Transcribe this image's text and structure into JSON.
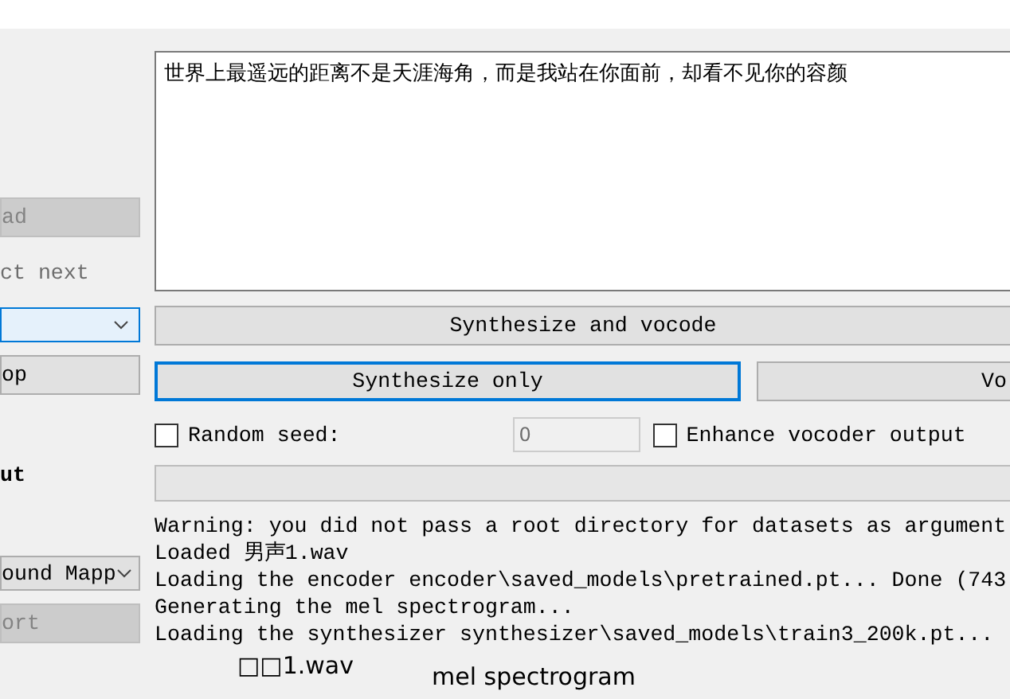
{
  "left_panel": {
    "load_button": {
      "label": "ad",
      "disabled": true
    },
    "select_label": "ct next",
    "stop_button": {
      "label": "op",
      "disabled": false
    },
    "output_heading": "ut",
    "dropdown_2": {
      "value": "ound Mapp"
    },
    "export_button": {
      "label": "ort",
      "disabled": true
    }
  },
  "text_input": {
    "value": "世界上最遥远的距离不是天涯海角，而是我站在你面前，却看不见你的容颜"
  },
  "buttons": [
    {
      "label": "Synthesize and vocode",
      "focused": false
    },
    {
      "label": "Synthesize only",
      "focused": true
    },
    {
      "label": "Vo",
      "focused": false
    }
  ],
  "random_seed": {
    "label": "Random seed:",
    "checked": false,
    "value": "0",
    "disabled": true
  },
  "enhance_vocoder": {
    "label": "Enhance vocoder output",
    "checked": false
  },
  "progress": {
    "level": 0
  },
  "log": [
    "Warning: you did not pass a root directory for datasets as argument",
    "Loaded 男声1.wav",
    "Loading the encoder encoder\\saved_models\\pretrained.pt... Done (743",
    "Generating the mel spectrogram...",
    "Loading the synthesizer synthesizer\\saved_models\\train3_200k.pt..."
  ],
  "plot_titles": [
    "□□1.wav",
    "mel spectrogram"
  ]
}
